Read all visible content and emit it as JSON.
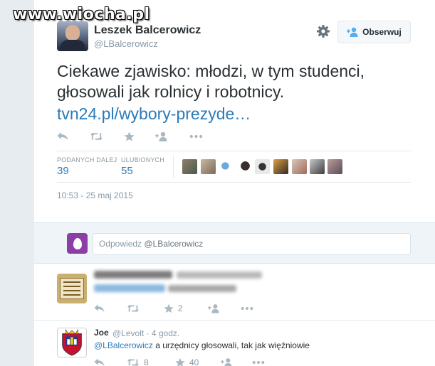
{
  "watermark": "www.wiocha.pl",
  "tweet": {
    "author_name": "Leszek Balcerowicz",
    "author_handle": "@LBalcerowicz",
    "follow_label": "Obserwuj",
    "text_line1": "Ciekawe zjawisko: młodzi, w tym studenci,",
    "text_line2": "głosowali jak rolnicy i robotnicy.",
    "link_text": "tvn24.pl/wybory-prezyde…",
    "stats": {
      "retweets_label": "PODANYCH DALEJ",
      "retweets_value": "39",
      "favorites_label": "ULUBIONYCH",
      "favorites_value": "55"
    },
    "timestamp": "10:53 - 25 maj 2015"
  },
  "reply_box": {
    "placeholder": "Odpowiedz ",
    "mention": "@LBalcerowicz"
  },
  "replies": [
    {
      "author_blurred": true,
      "favorites": "2"
    },
    {
      "author_name": "Joe",
      "meta": "@Levolt · 4 godz.",
      "mention": "@LBalcerowicz",
      "text": " a urzędnicy głosowali, tak jak więźniowie",
      "retweets": "8",
      "favorites": "40"
    }
  ],
  "colors": {
    "link": "#2b7bb9",
    "muted": "#8899a6",
    "text": "#292f33",
    "egg": "#8b3fa5"
  },
  "icons": [
    "reply-icon",
    "retweet-icon",
    "star-icon",
    "follow-icon",
    "more-icon",
    "gear-icon",
    "add-user-icon"
  ]
}
